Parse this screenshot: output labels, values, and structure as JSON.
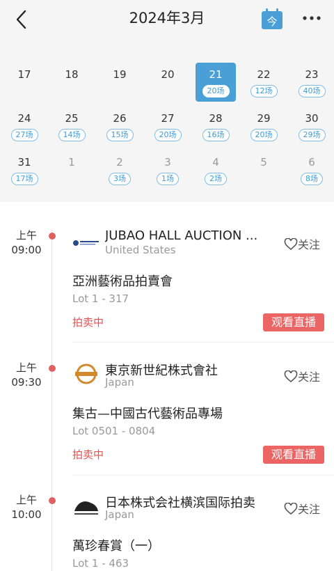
{
  "header": {
    "title": "2024年3月",
    "today_icon_label": "今",
    "back_icon": "chevron-left-icon",
    "more_icon": "more-dots-icon"
  },
  "calendar": {
    "days": [
      {
        "num": "17",
        "count": ""
      },
      {
        "num": "18",
        "count": ""
      },
      {
        "num": "19",
        "count": ""
      },
      {
        "num": "20",
        "count": ""
      },
      {
        "num": "21",
        "count": "20场",
        "selected": true
      },
      {
        "num": "22",
        "count": "12场"
      },
      {
        "num": "23",
        "count": "40场"
      },
      {
        "num": "24",
        "count": "27场"
      },
      {
        "num": "25",
        "count": "14场"
      },
      {
        "num": "26",
        "count": "15场"
      },
      {
        "num": "27",
        "count": "20场"
      },
      {
        "num": "28",
        "count": "16场"
      },
      {
        "num": "29",
        "count": "20场"
      },
      {
        "num": "30",
        "count": "29场"
      },
      {
        "num": "31",
        "count": "17场"
      },
      {
        "num": "1",
        "count": "",
        "dim": true
      },
      {
        "num": "2",
        "count": "3场",
        "dim": true
      },
      {
        "num": "3",
        "count": "1场",
        "dim": true
      },
      {
        "num": "4",
        "count": "2场",
        "dim": true
      },
      {
        "num": "5",
        "count": "",
        "dim": true
      },
      {
        "num": "6",
        "count": "8场",
        "dim": true
      }
    ]
  },
  "auctions": [
    {
      "ampm": "上午",
      "time": "09:00",
      "house": "JUBAO HALL AUCTION ...",
      "country": "United States",
      "follow": "关注",
      "sale": "亞洲藝術品拍賣會",
      "lot": "Lot 1 - 317",
      "status": "拍卖中",
      "live": "观看直播"
    },
    {
      "ampm": "上午",
      "time": "09:30",
      "house": "東京新世紀株式會社",
      "country": "Japan",
      "follow": "关注",
      "sale": "集古—中國古代藝術品專場",
      "lot": "Lot 0501 - 0804",
      "status": "拍卖中",
      "live": "观看直播"
    },
    {
      "ampm": "上午",
      "time": "10:00",
      "house": "日本株式会社横滨国际拍卖",
      "country": "Japan",
      "follow": "关注",
      "sale": "萬珍春賞（一）",
      "lot": "Lot 1 - 463"
    }
  ],
  "colors": {
    "accent": "#4aa0d6",
    "live": "#ec6565",
    "status": "#e05050",
    "dot": "#e06161"
  }
}
